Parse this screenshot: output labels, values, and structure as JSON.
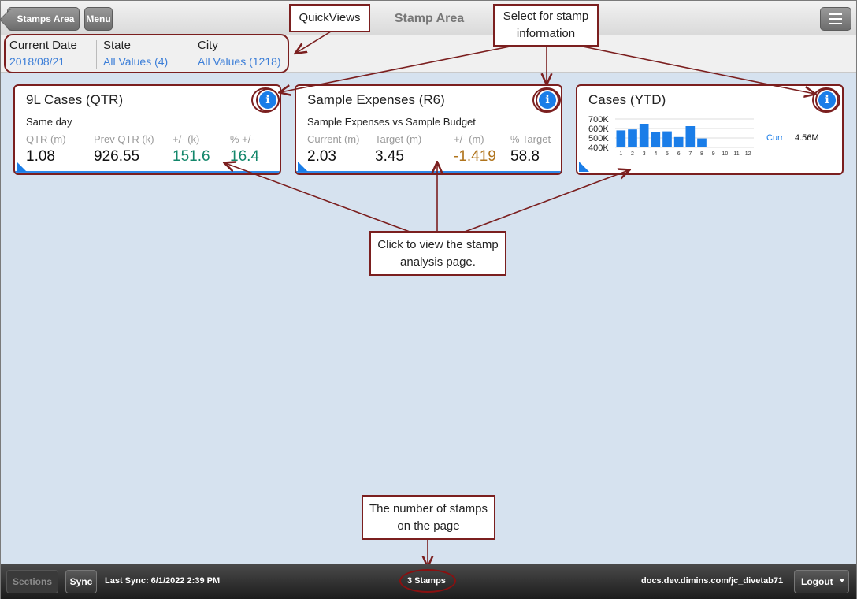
{
  "header": {
    "back_label": "Stamps Area",
    "menu_label": "Menu",
    "title": "Stamp Area"
  },
  "quickviews": [
    {
      "label": "Current Date",
      "value": "2018/08/21"
    },
    {
      "label": "State",
      "value": "All Values (4)"
    },
    {
      "label": "City",
      "value": "All Values (1218)"
    }
  ],
  "stamps": [
    {
      "title": "9L Cases (QTR)",
      "subtitle": "Same day",
      "metrics": [
        {
          "header": "QTR (m)",
          "value": "1.08"
        },
        {
          "header": "Prev QTR (k)",
          "value": "926.55"
        },
        {
          "header": "+/- (k)",
          "value": "151.6"
        },
        {
          "header": "% +/-",
          "value": "16.4"
        }
      ]
    },
    {
      "title": "Sample Expenses (R6)",
      "subtitle": "Sample Expenses vs Sample Budget",
      "metrics": [
        {
          "header": "Current (m)",
          "value": "2.03"
        },
        {
          "header": "Target (m)",
          "value": "3.45"
        },
        {
          "header": "+/- (m)",
          "value": "-1.419"
        },
        {
          "header": "% Target",
          "value": "58.8"
        }
      ]
    },
    {
      "title": "Cases (YTD)",
      "legend_label": "Curr",
      "legend_value": "4.56M"
    }
  ],
  "chart_data": {
    "type": "bar",
    "categories": [
      "1",
      "2",
      "3",
      "4",
      "5",
      "6",
      "7",
      "8",
      "9",
      "10",
      "11",
      "12"
    ],
    "values": [
      580000,
      590000,
      650000,
      565000,
      570000,
      510000,
      625000,
      495000,
      null,
      null,
      null,
      null
    ],
    "yticks": [
      "700K",
      "600K",
      "500K",
      "400K"
    ],
    "ylim": [
      400000,
      700000
    ],
    "bar_color": "#1a7de8",
    "grid": true
  },
  "callouts": {
    "quickviews": "QuickViews",
    "select_info": "Select for stamp information",
    "click_view": "Click to view the stamp analysis page.",
    "stamp_count": "The number of stamps on the page"
  },
  "footer": {
    "sections_label": "Sections",
    "sync_label": "Sync",
    "last_sync": "Last Sync: 6/1/2022 2:39 PM",
    "stamp_count": "3 Stamps",
    "url": "docs.dev.dimins.com/jc_divetab71",
    "logout_label": "Logout"
  },
  "colors": {
    "accent": "#1a7de8",
    "positive": "#13876b",
    "negative": "#b0741c",
    "annotation": "#7b1f1f"
  }
}
